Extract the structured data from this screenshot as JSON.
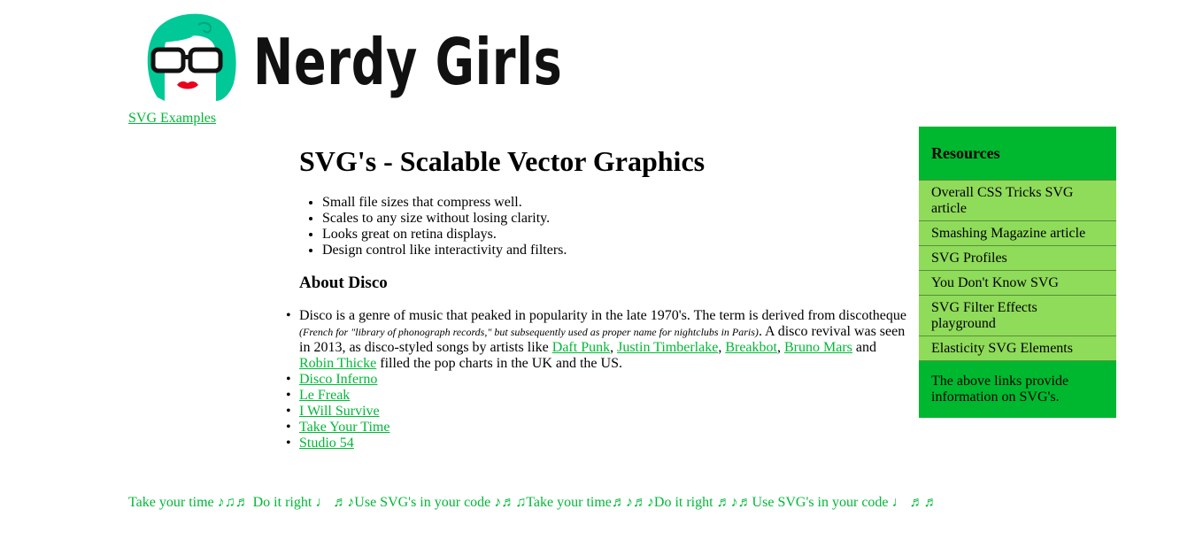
{
  "header": {
    "logo_text": "Nerdy Girls",
    "nav_link": "SVG Examples"
  },
  "main": {
    "title": "SVG's - Scalable Vector Graphics",
    "features": [
      "Small file sizes that compress well.",
      "Scales to any size without losing clarity.",
      "Looks great on retina displays.",
      "Design control like interactivity and filters."
    ],
    "section_heading": "About Disco",
    "disco_text_1": "Disco is a genre of music that peaked in popularity in the late 1970's. The term is derived from discotheque ",
    "disco_small": "(French for \"library of phonograph records,\" but subsequently used as proper name for nightclubs in Paris)",
    "disco_text_2": ". A disco revival was seen in 2013, as disco-styled songs by artists like ",
    "artists": [
      "Daft Punk",
      "Justin Timberlake",
      "Breakbot",
      "Bruno Mars",
      "Robin Thicke"
    ],
    "sep_comma": ", ",
    "sep_and": " and ",
    "disco_text_3": " filled the pop charts in the UK and the US.",
    "songs": [
      "Disco Inferno",
      "Le Freak",
      "I Will Survive",
      "Take Your Time",
      "Studio 54"
    ]
  },
  "sidebar": {
    "heading": "Resources",
    "links": [
      "Overall CSS Tricks SVG article",
      "Smashing Magazine article",
      "SVG Profiles",
      "You Don't Know SVG",
      "SVG Filter Effects playground",
      "Elasticity SVG Elements"
    ],
    "note": "The above links provide information on SVG's."
  },
  "footer": {
    "marquee": "Take your time ♪♫♬ Do it right  ♩ ♬♪Use SVG's in your code ♪♬♫Take your time♬♪♬♪Do it right ♬♪♬Use SVG's in your code ♩ ♬♬"
  },
  "colors": {
    "accent": "#00b836",
    "sidebar_bg": "#00b82f",
    "sidebar_item_bg": "#8fdb5a",
    "logo_hair": "#00c896",
    "logo_lips": "#e8001c"
  },
  "icons": {
    "logo": "nerdy-girl-face-icon"
  }
}
